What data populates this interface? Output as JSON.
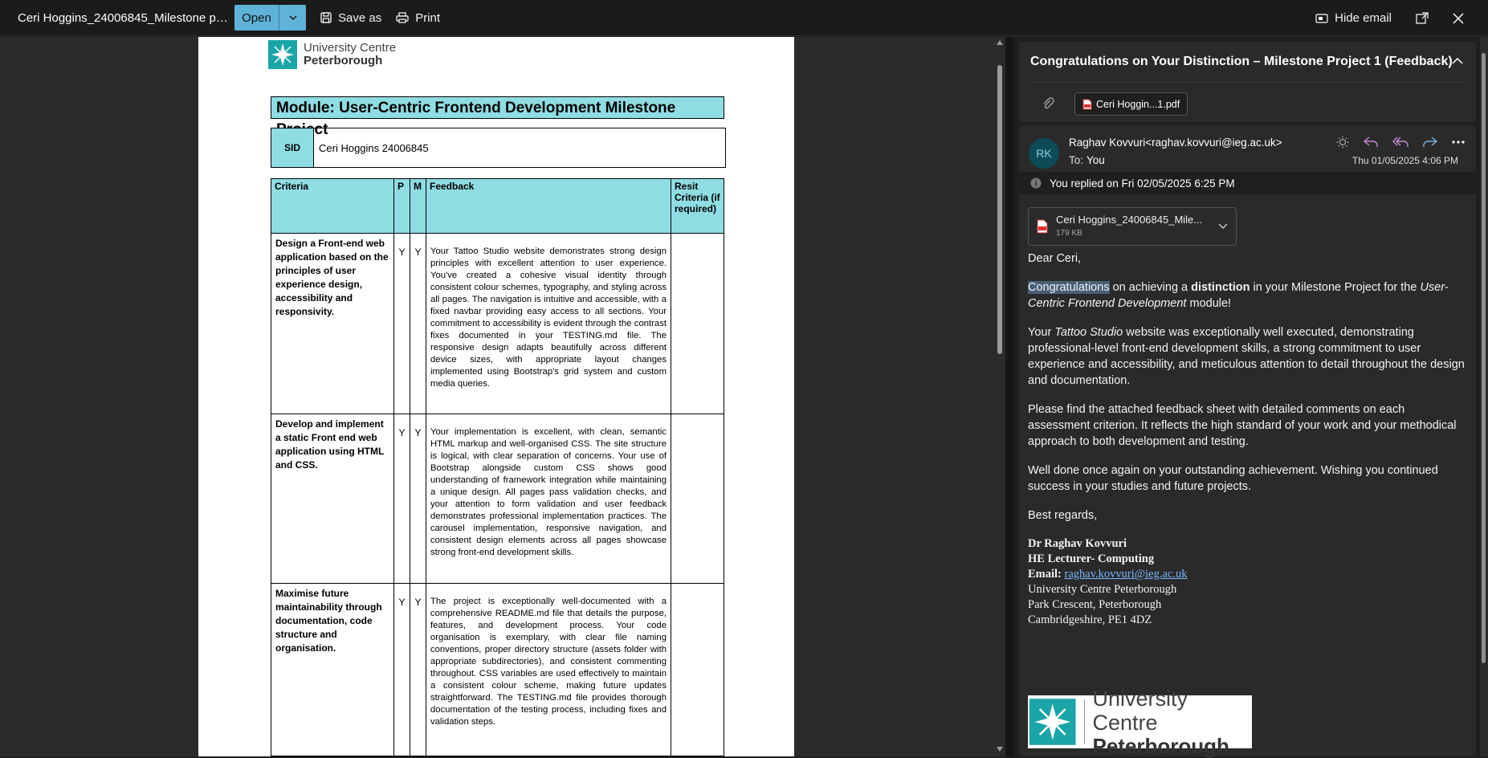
{
  "topbar": {
    "title": "Ceri Hoggins_24006845_Milestone proje...",
    "open_label": "Open",
    "save_label": "Save as",
    "print_label": "Print",
    "hide_label": "Hide email"
  },
  "document": {
    "logo_line1": "University Centre",
    "logo_line2": "Peterborough",
    "module_title": "Module: User-Centric Frontend Development Milestone Project",
    "sid_label": "SID",
    "sid_value": "Ceri Hoggins 24006845",
    "headers": {
      "criteria": "Criteria",
      "p": "P",
      "m": "M",
      "feedback": "Feedback",
      "resit": "Resit Criteria (if required)"
    },
    "rows": [
      {
        "criteria": "Design a Front-end web application based on the principles of user experience design, accessibility and responsivity.",
        "p": "Y",
        "m": "Y",
        "feedback": "Your Tattoo Studio website demonstrates strong design principles with excellent attention to user experience. You've created a cohesive visual identity through consistent colour schemes, typography, and styling across all pages. The navigation is intuitive and accessible, with a fixed navbar providing easy access to all sections. Your commitment to accessibility is evident through the contrast fixes documented in your TESTING.md file. The responsive design adapts beautifully across different device sizes, with appropriate layout changes implemented using Bootstrap's grid system and custom media queries."
      },
      {
        "criteria": "Develop and implement a static Front end web application using HTML and CSS.",
        "p": "Y",
        "m": "Y",
        "feedback": "Your implementation is excellent, with clean, semantic HTML markup and well-organised CSS. The site structure is logical, with clear separation of concerns. Your use of Bootstrap alongside custom CSS shows good understanding of framework integration while maintaining a unique design. All pages pass validation checks, and your attention to form validation and user feedback demonstrates professional implementation practices. The carousel implementation, responsive navigation, and consistent design elements across all pages showcase strong front-end development skills."
      },
      {
        "criteria": "Maximise future maintainability through documentation, code structure and organisation.",
        "p": "Y",
        "m": "Y",
        "feedback": "The project is exceptionally well-documented with a comprehensive README.md file that details the purpose, features, and development process. Your code organisation is exemplary, with clear file naming conventions, proper directory structure (assets folder with appropriate subdirectories), and consistent commenting throughout. CSS variables are used effectively to maintain a consistent colour scheme, making future updates straightforward. The TESTING.md file provides thorough documentation of the testing process, including fixes and validation steps."
      }
    ]
  },
  "email": {
    "subject": "Congratulations on Your Distinction – Milestone Project 1 (Feedback)",
    "attachment_chip": "Ceri Hoggin...1.pdf",
    "avatar_initials": "RK",
    "sender": "Raghav Kovvuri<raghav.kovvuri@ieg.ac.uk>",
    "to_label": "To:",
    "to_value": "You",
    "date": "Thu 01/05/2025 4:06 PM",
    "replied_notice": "You replied on Fri 02/05/2025 6:25 PM",
    "attachment_name": "Ceri Hoggins_24006845_Mile...",
    "attachment_size": "179 KB",
    "greeting": "Dear Ceri,",
    "p1_highlight": "Congratulations",
    "p1_a": " on achieving a ",
    "p1_bold": "distinction",
    "p1_b": " in your Milestone Project for the ",
    "p1_italic": "User-Centric Frontend Development",
    "p1_c": " module!",
    "p2_a": "Your ",
    "p2_italic": "Tattoo Studio",
    "p2_b": " website was exceptionally well executed, demonstrating professional-level front-end development skills, a strong commitment to user experience and accessibility, and meticulous attention to detail throughout the design and documentation.",
    "p3": "Please find the attached feedback sheet with detailed comments on each assessment criterion. It reflects the high standard of your work and your methodical approach to both development and testing.",
    "p4": "Well done once again on your outstanding achievement. Wishing you continued success in your studies and future projects.",
    "closing": "Best regards,",
    "sig_name": "Dr Raghav Kovvuri",
    "sig_title": "HE Lecturer- Computing",
    "sig_email_label": "Email:",
    "sig_email": "raghav.kovvuri@ieg.ac.uk",
    "sig_addr1": "University Centre Peterborough",
    "sig_addr2": "Park Crescent, Peterborough",
    "sig_addr3": "Cambridgeshire, PE1 4DZ",
    "logo_line1": "University Centre",
    "logo_line2": "Peterborough"
  },
  "colors": {
    "accent": "#5fb3d9",
    "table_header": "#8fdde3",
    "logo_teal": "#1aa5a8"
  }
}
